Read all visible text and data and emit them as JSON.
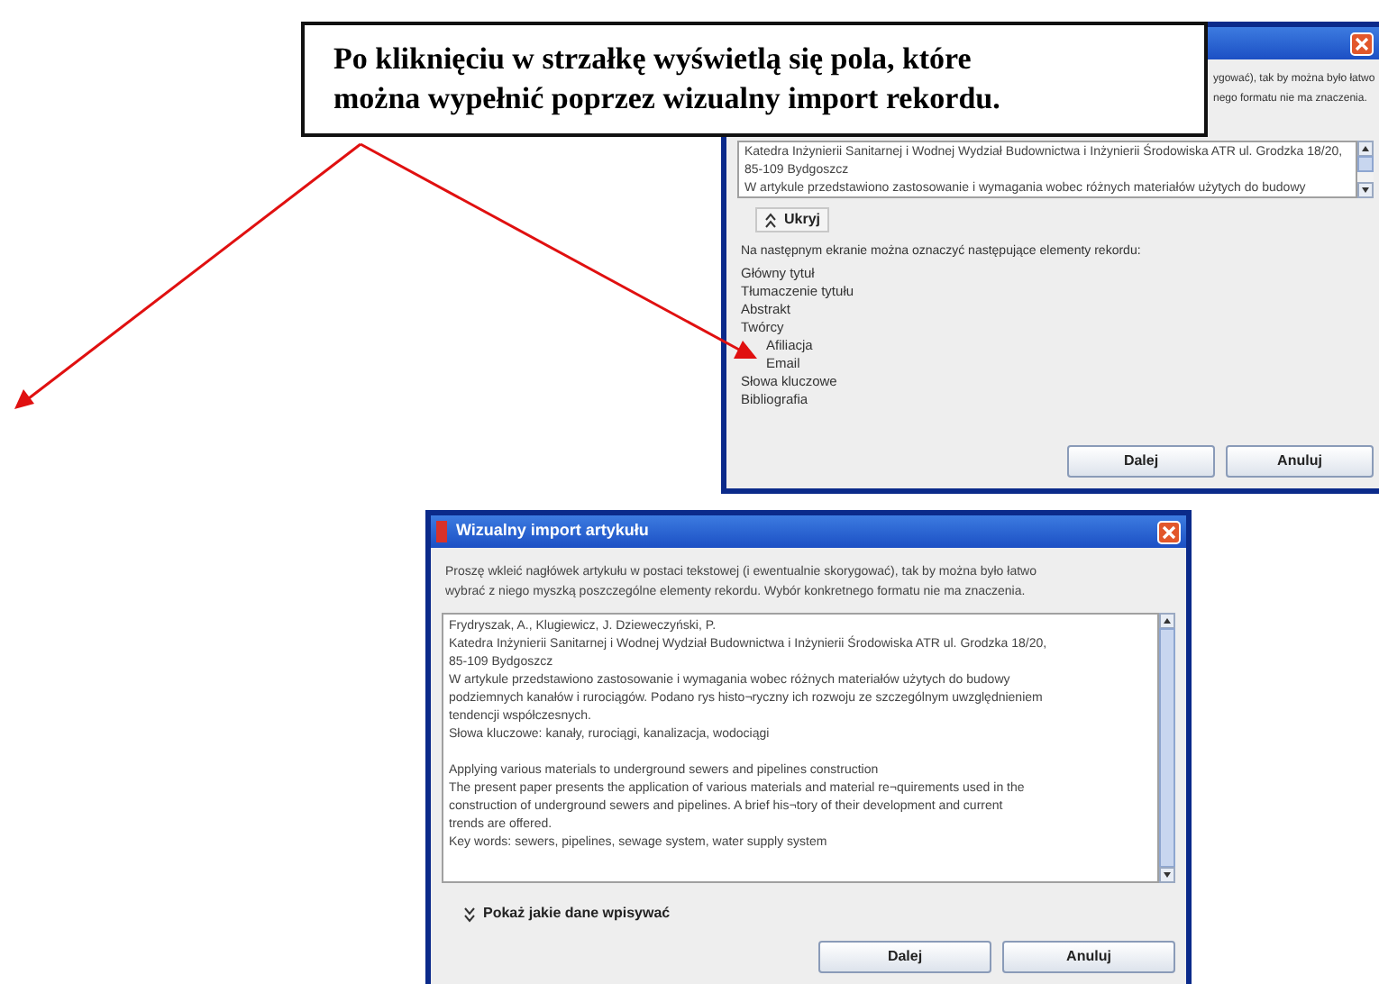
{
  "callout": {
    "lines": [
      "Po kliknięciu w strzałkę wyświetlą się pola, które",
      "można wypełnić poprzez wizualny import rekordu."
    ]
  },
  "top_window": {
    "instructions": [
      "ygować), tak by można było łatwo",
      "nego formatu nie ma znaczenia."
    ],
    "text_area_lines": [
      "Katedra Inżynierii Sanitarnej i Wodnej Wydział Budownictwa i Inżynierii Środowiska ATR ul. Grodzka 18/20,",
      "85-109 Bydgoszcz",
      "W artykule przedstawiono zastosowanie i wymagania wobec różnych materiałów użytych do budowy"
    ],
    "toggle": {
      "label": "Ukryj",
      "expanded": true
    },
    "fields_label": "Na następnym ekranie można oznaczyć następujące elementy rekordu:",
    "fields": [
      {
        "label": "Główny tytuł"
      },
      {
        "label": "Tłumaczenie tytułu"
      },
      {
        "label": "Abstrakt"
      },
      {
        "label": "Twórcy",
        "children": [
          {
            "label": "Afiliacja"
          },
          {
            "label": "Email"
          }
        ]
      },
      {
        "label": "Słowa kluczowe"
      },
      {
        "label": "Bibliografia"
      }
    ],
    "buttons": [
      "Dalej",
      "Anuluj"
    ]
  },
  "bottom_window": {
    "title": "Wizualny import artykułu",
    "instructions": [
      "Proszę wkleić nagłówek artykułu w postaci tekstowej (i ewentualnie skorygować), tak by można było łatwo",
      "wybrać z niego myszką poszczególne elementy rekordu. Wybór konkretnego formatu nie ma znaczenia."
    ],
    "text_blocks": [
      [
        "Frydryszak, A., Klugiewicz, J. Dzieweczyński, P.",
        "Katedra Inżynierii Sanitarnej i Wodnej Wydział Budownictwa i Inżynierii Środowiska ATR ul. Grodzka 18/20,",
        "85-109 Bydgoszcz",
        "W artykule przedstawiono zastosowanie i wymagania wobec różnych materiałów użytych do budowy",
        "podziemnych kanałów i rurociągów. Podano rys histo¬ryczny ich rozwoju ze szczególnym uwzględnieniem",
        "tendencji współczesnych.",
        "Słowa kluczowe: kanały, rurociągi, kanalizacja, wodociągi"
      ],
      [
        "Applying various materials to underground sewers and pipelines construction",
        "The present paper presents the application of various materials and material re¬quirements used in the",
        "construction of underground sewers and pipelines. A brief his¬tory of their development and current",
        "trends are offered.",
        "Key words: sewers, pipelines, sewage system, water supply system"
      ]
    ],
    "toggle": {
      "label": "Pokaż jakie dane wpisywać",
      "expanded": false
    },
    "buttons": [
      "Dalej",
      "Anuluj"
    ]
  }
}
